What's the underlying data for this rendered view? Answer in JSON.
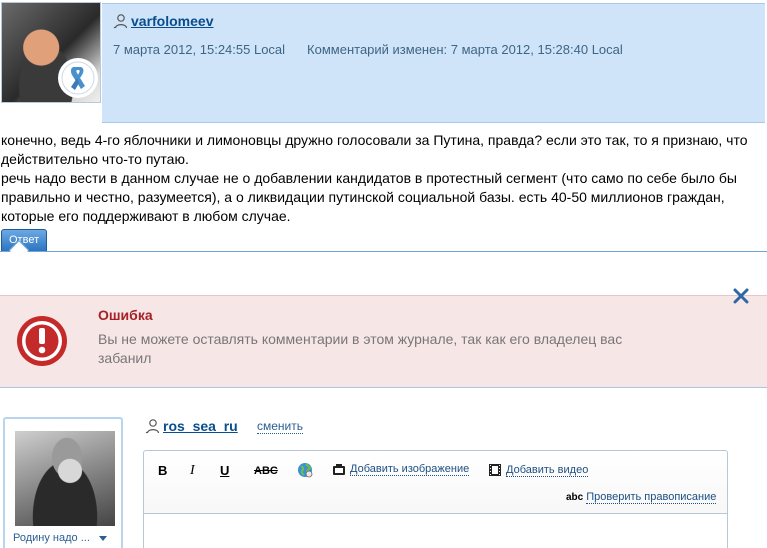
{
  "comment": {
    "author": "varfolomeev",
    "posted": "7 марта 2012, 15:24:55 Local",
    "edited": "Комментарий изменен: 7 марта 2012, 15:28:40 Local",
    "line1": "конечно, ведь 4-го яблочники и лимоновцы дружно голосовали за Путина, правда? если это так, то я признаю, что действительно что-то путаю.",
    "line2": "речь надо вести в данном случае не о добавлении кандидатов в протестный сегмент (что само по себе было бы правильно и честно, разумеется), а о ликвидации путинской социальной базы. есть 40-50 миллионов граждан, которые его поддерживают в любом случае.",
    "reply_label": "Ответ"
  },
  "error": {
    "title": "Ошибка",
    "text": "Вы не можете оставлять комментарии в этом журнале, так как его владелец вас забанил"
  },
  "compose": {
    "avatar_caption": "Родину надо ...",
    "username": "ros_sea_ru",
    "change_label": "сменить",
    "toolbar": {
      "bold": "B",
      "italic": "I",
      "underline": "U",
      "strike": "ABC",
      "add_image": "Добавить изображение",
      "add_video": "Добавить видео",
      "spell_abc": "abc",
      "spellcheck": "Проверить правописание"
    }
  },
  "colors": {
    "header_bg": "#cfe4f8",
    "link": "#0a4d8c",
    "error_bg": "#f7e6e6",
    "error_title": "#a62126"
  }
}
